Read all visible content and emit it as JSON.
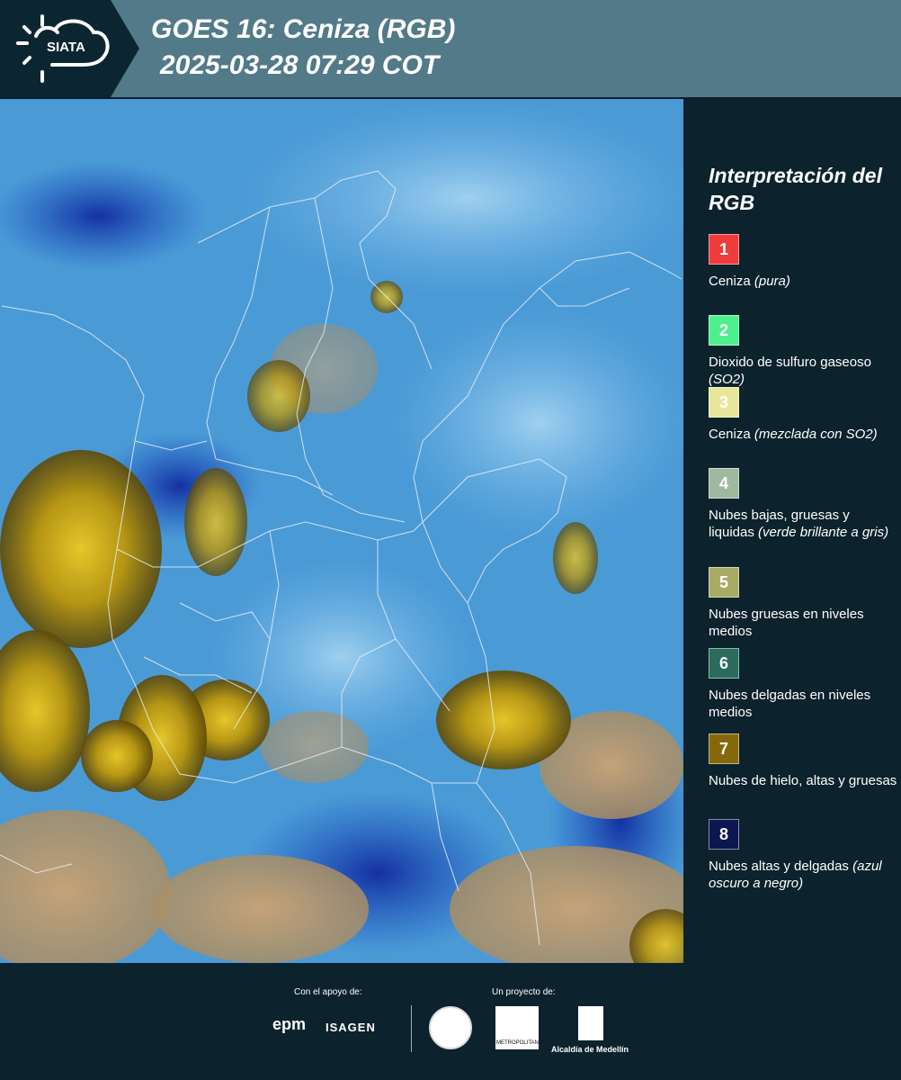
{
  "header": {
    "logo_text": "SIATA",
    "title": "GOES 16: Ceniza (RGB)",
    "subtitle": "2025-03-28 07:29 COT"
  },
  "legend": {
    "title": "Interpretación del RGB",
    "items": [
      {
        "number": "1",
        "color": "#ef3b3b",
        "label": "Ceniza",
        "note": "(pura)"
      },
      {
        "number": "2",
        "color": "#4ef08e",
        "label": "Dioxido de sulfuro gaseoso",
        "note": "(SO2)"
      },
      {
        "number": "3",
        "color": "#e8e69a",
        "label": "Ceniza",
        "note": "(mezclada con SO2)"
      },
      {
        "number": "4",
        "color": "#9fb9a0",
        "label": "Nubes bajas, gruesas y liquidas",
        "note": "(verde brillante a gris)"
      },
      {
        "number": "5",
        "color": "#a8ab64",
        "label": "Nubes gruesas en niveles medios",
        "note": ""
      },
      {
        "number": "6",
        "color": "#2a6b5c",
        "label": "Nubes delgadas en niveles medios",
        "note": ""
      },
      {
        "number": "7",
        "color": "#86680c",
        "label": "Nubes de hielo, altas y gruesas",
        "note": ""
      },
      {
        "number": "8",
        "color": "#0c1650",
        "label": "Nubes altas y delgadas",
        "note": "(azul oscuro a negro)"
      }
    ]
  },
  "footer": {
    "support_label": "Con el apoyo de:",
    "project_label": "Un proyecto de:",
    "sponsor_1": "epm",
    "sponsor_2": "ISAGEN",
    "area_logo_text": "METROPOLITANA",
    "alcaldia": "Alcaldía de Medellín"
  },
  "colors": {
    "header_bg": "#527a89",
    "panel_bg": "#0c222d",
    "map_blue": "#3f8fcf",
    "map_land": "#b89a6e",
    "map_cloud_ice": "#c9a814"
  }
}
